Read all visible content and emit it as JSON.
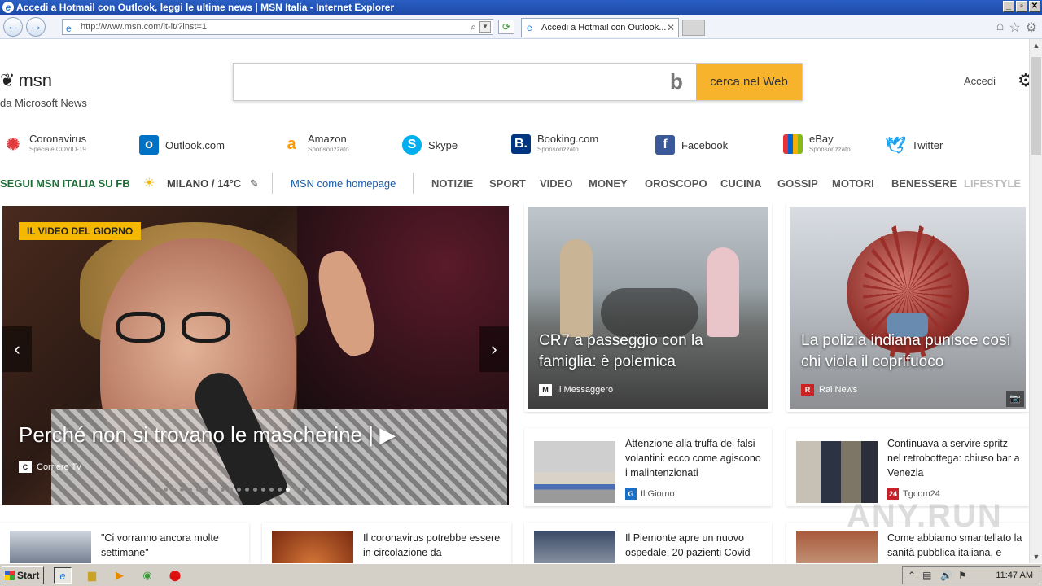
{
  "window": {
    "title": "Accedi a Hotmail con Outlook, leggi le ultime news | MSN Italia - Internet Explorer",
    "controls": [
      "_",
      "▫",
      "✕"
    ]
  },
  "browser": {
    "url": "http://www.msn.com/it-it/?inst=1",
    "tab_title": "Accedi a Hotmail con Outlook...",
    "back_icon": "back-arrow-icon",
    "forward_icon": "forward-arrow-icon"
  },
  "header": {
    "logo_text": "msn",
    "logo_sub": "da Microsoft News",
    "search_placeholder": "",
    "search_button": "cerca nel Web",
    "signin": "Accedi"
  },
  "shortcuts": [
    {
      "label": "Coronavirus",
      "sub": "Speciale COVID-19",
      "icon": "virus-icon",
      "color": "#e03a3e"
    },
    {
      "label": "Outlook.com",
      "sub": "",
      "icon": "outlook-icon",
      "color": "#0072c6"
    },
    {
      "label": "Amazon",
      "sub": "Sponsorizzato",
      "icon": "amazon-icon",
      "color": "#ff9900"
    },
    {
      "label": "Skype",
      "sub": "",
      "icon": "skype-icon",
      "color": "#00aff0"
    },
    {
      "label": "Booking.com",
      "sub": "Sponsorizzato",
      "icon": "booking-icon",
      "color": "#003580"
    },
    {
      "label": "Facebook",
      "sub": "",
      "icon": "facebook-icon",
      "color": "#3b5998"
    },
    {
      "label": "eBay",
      "sub": "Sponsorizzato",
      "icon": "ebay-icon",
      "color": "#e53238"
    },
    {
      "label": "Twitter",
      "sub": "",
      "icon": "twitter-icon",
      "color": "#1da1f2"
    }
  ],
  "nav": {
    "follow": "SEGUI MSN ITALIA SU FB",
    "weather": "MILANO / 14°C",
    "homepage": "MSN come homepage",
    "categories": [
      "NOTIZIE",
      "SPORT",
      "VIDEO",
      "MONEY",
      "OROSCOPO",
      "CUCINA",
      "GOSSIP",
      "MOTORI",
      "BENESSERE",
      "LIFESTYLE"
    ]
  },
  "hero": {
    "badge": "IL VIDEO DEL GIORNO",
    "title": "Perché non si trovano le mascherine",
    "source": "Corriere Tv",
    "slide_count": 20,
    "active_slide": 16
  },
  "tiles": [
    {
      "caption": "CR7 a passeggio con la famiglia: è polemica",
      "source": "Il Messaggero"
    },
    {
      "caption": "La polizia indiana punisce così chi viola il coprifuoco",
      "source": "Rai News"
    }
  ],
  "stories_row1": [
    {
      "title": "Attenzione alla truffa dei falsi volantini: ecco come agiscono i malintenzionati",
      "source": "Il Giorno"
    },
    {
      "title": "Continuava a servire spritz nel retrobottega: chiuso bar a Venezia",
      "source": "Tgcom24"
    }
  ],
  "stories_row2": [
    {
      "title": "\"Ci vorranno ancora molte settimane\"",
      "source": ""
    },
    {
      "title": "Il coronavirus potrebbe essere in circolazione da",
      "source": ""
    },
    {
      "title": "Il Piemonte apre un nuovo ospedale, 20 pazienti Covid-",
      "source": ""
    },
    {
      "title": "Come abbiamo smantellato la sanità pubblica italiana, e",
      "source": ""
    }
  ],
  "taskbar": {
    "start": "Start",
    "clock": "11:47 AM"
  },
  "watermark": "ANY.RUN"
}
